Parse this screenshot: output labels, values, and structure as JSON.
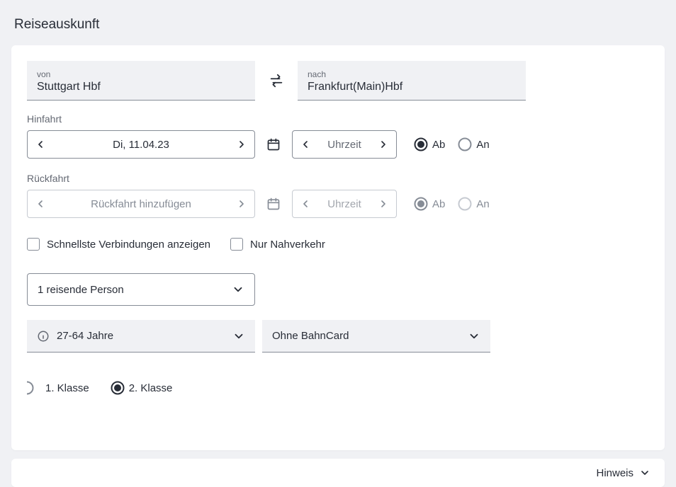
{
  "page": {
    "title": "Reiseauskunft"
  },
  "stations": {
    "from_label": "von",
    "from_value": "Stuttgart Hbf",
    "to_label": "nach",
    "to_value": "Frankfurt(Main)Hbf"
  },
  "outbound": {
    "label": "Hinfahrt",
    "date": "Di, 11.04.23",
    "time_placeholder": "Uhrzeit",
    "radio_ab": "Ab",
    "radio_an": "An",
    "radio_selected": "ab"
  },
  "return": {
    "label": "Rückfahrt",
    "placeholder": "Rückfahrt hinzufügen",
    "time_placeholder": "Uhrzeit",
    "radio_ab": "Ab",
    "radio_an": "An"
  },
  "options": {
    "fastest": "Schnellste Verbindungen anzeigen",
    "local_only": "Nur Nahverkehr"
  },
  "travelers": {
    "label": "1 reisende Person"
  },
  "age": {
    "label": "27-64 Jahre"
  },
  "bahncard": {
    "label": "Ohne BahnCard"
  },
  "class": {
    "first": "1. Klasse",
    "second": "2. Klasse",
    "selected": "second"
  },
  "footer": {
    "hint": "Hinweis"
  }
}
